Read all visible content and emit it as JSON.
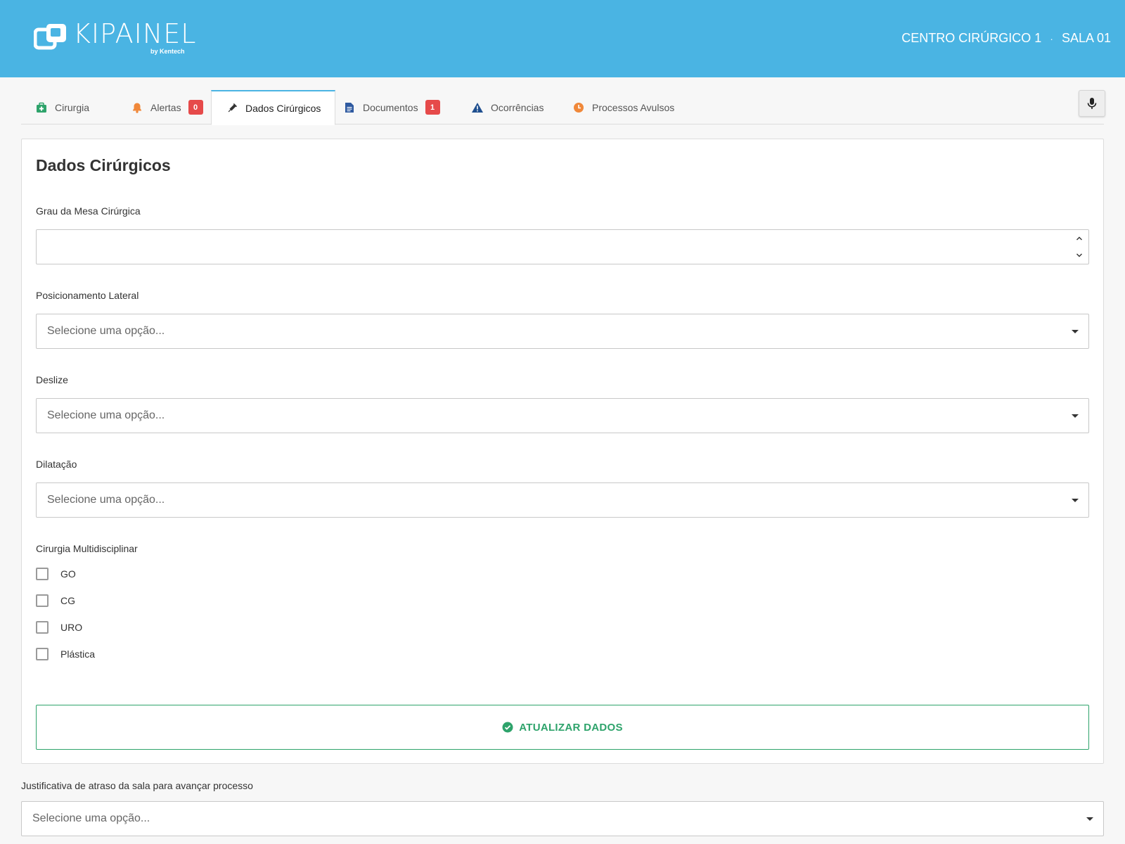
{
  "header": {
    "logo_text": "KIPAINEL",
    "logo_sub": "by Kentech",
    "location": "CENTRO CIRÚRGICO 1",
    "separator": "·",
    "room": "SALA 01",
    "background_color": "#4ab4e3"
  },
  "tabs": [
    {
      "label": "Cirurgia",
      "icon": "medical-kit-icon",
      "icon_color": "#2ea36b"
    },
    {
      "label": "Alertas",
      "icon": "bell-icon",
      "icon_color": "#f0883a",
      "badge": "0"
    },
    {
      "label": "Dados Cirúrgicos",
      "icon": "syringe-icon",
      "icon_color": "#333333",
      "active": true
    },
    {
      "label": "Documentos",
      "icon": "document-icon",
      "icon_color": "#2f5aa0",
      "badge": "1"
    },
    {
      "label": "Ocorrências",
      "icon": "warning-icon",
      "icon_color": "#1f4f8f"
    },
    {
      "label": "Processos Avulsos",
      "icon": "clock-icon",
      "icon_color": "#f0883a"
    }
  ],
  "mic_icon": "microphone-icon",
  "form": {
    "title": "Dados Cirúrgicos",
    "grau_mesa": {
      "label": "Grau da Mesa Cirúrgica",
      "value": ""
    },
    "posicionamento": {
      "label": "Posicionamento Lateral",
      "placeholder": "Selecione uma opção..."
    },
    "deslize": {
      "label": "Deslize",
      "placeholder": "Selecione uma opção..."
    },
    "dilatacao": {
      "label": "Dilatação",
      "placeholder": "Selecione uma opção..."
    },
    "multidisciplinar": {
      "label": "Cirurgia Multidisciplinar",
      "options": [
        {
          "label": "GO",
          "checked": false
        },
        {
          "label": "CG",
          "checked": false
        },
        {
          "label": "URO",
          "checked": false
        },
        {
          "label": "Plástica",
          "checked": false
        }
      ]
    },
    "update_button_label": "ATUALIZAR DADOS",
    "update_button_color": "#2ea36b"
  },
  "justificativa": {
    "label": "Justificativa de atraso da sala para avançar processo",
    "placeholder": "Selecione uma opção..."
  }
}
